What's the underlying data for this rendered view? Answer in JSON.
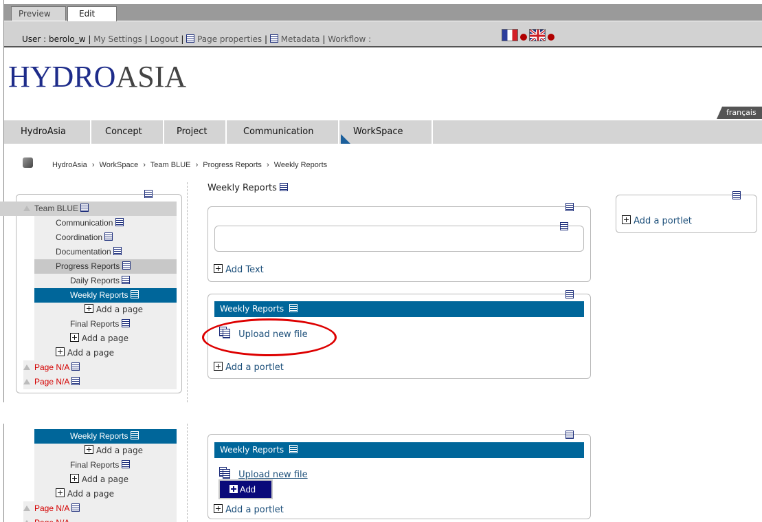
{
  "tabs": {
    "preview": "Preview",
    "edit": "Edit"
  },
  "toolbar": {
    "user_label": "User : berolo_w",
    "sep": "|",
    "my_settings": "My Settings",
    "logout": "Logout",
    "page_properties": "Page properties",
    "metadata": "Metadata",
    "workflow": "Workflow :"
  },
  "logo": {
    "part1": "HYDRO",
    "part2": "ASIA"
  },
  "language_tab": "français",
  "nav": [
    "HydroAsia",
    "Concept",
    "Project",
    "Communication",
    "WorkSpace"
  ],
  "breadcrumb": [
    "HydroAsia",
    "WorkSpace",
    "Team BLUE",
    "Progress Reports",
    "Weekly Reports"
  ],
  "breadcrumb_sep": "›",
  "tree": {
    "team": "Team BLUE",
    "communication": "Communication",
    "coordination": "Coordination",
    "documentation": "Documentation",
    "progress": "Progress Reports",
    "daily": "Daily Reports",
    "weekly": "Weekly Reports",
    "add_page": "Add a page",
    "final": "Final Reports",
    "page_na": "Page N/A"
  },
  "main": {
    "title": "Weekly Reports",
    "add_text": "Add Text",
    "portlet_header": "Weekly Reports",
    "upload": "Upload new file",
    "add_portlet": "Add a portlet",
    "add_menu": "Add"
  },
  "right": {
    "add_portlet": "Add a portlet"
  },
  "colors": {
    "header_blue": "#006699",
    "tab_grey": "#d4d4d4",
    "highlight_red": "#dd0000",
    "menu_navy": "#0a0a7a"
  }
}
